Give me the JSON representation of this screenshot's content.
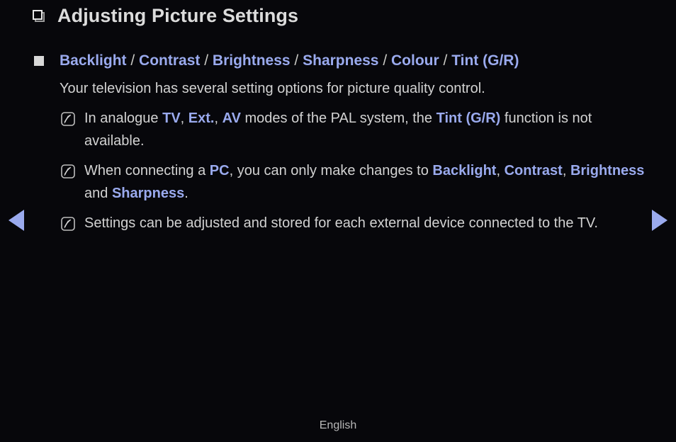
{
  "page": {
    "title": "Adjusting Picture Settings",
    "title_icon": "hollow-square-icon",
    "background_color": "#07070b",
    "accent_color": "#9aaaee",
    "text_color": "#d2d2d2"
  },
  "section": {
    "bullet_icon": "filled-square-bullet",
    "heading_parts": [
      {
        "text": "Backlight",
        "style": "em"
      },
      {
        "text": " / ",
        "style": "sep"
      },
      {
        "text": "Contrast",
        "style": "em"
      },
      {
        "text": " / ",
        "style": "sep"
      },
      {
        "text": "Brightness",
        "style": "em"
      },
      {
        "text": " / ",
        "style": "sep"
      },
      {
        "text": "Sharpness",
        "style": "em"
      },
      {
        "text": " / ",
        "style": "sep"
      },
      {
        "text": "Colour",
        "style": "em"
      },
      {
        "text": " / ",
        "style": "sep"
      },
      {
        "text": "Tint (G/R)",
        "style": "em"
      }
    ],
    "heading_plain": "Backlight / Contrast / Brightness / Sharpness / Colour / Tint (G/R)",
    "description": "Your television has several setting options for picture quality control."
  },
  "notes": [
    {
      "icon": "note-icon",
      "plain": "In analogue TV, Ext., AV modes of the PAL system, the Tint (G/R) function is not available.",
      "parts": [
        {
          "text": "In analogue ",
          "style": "plain"
        },
        {
          "text": "TV",
          "style": "em"
        },
        {
          "text": ", ",
          "style": "plain"
        },
        {
          "text": "Ext.",
          "style": "em"
        },
        {
          "text": ", ",
          "style": "plain"
        },
        {
          "text": "AV",
          "style": "em"
        },
        {
          "text": " modes of the PAL system, the ",
          "style": "plain"
        },
        {
          "text": "Tint (G/R)",
          "style": "em"
        },
        {
          "text": " function is not available.",
          "style": "plain"
        }
      ]
    },
    {
      "icon": "note-icon",
      "plain": "When connecting a PC, you can only make changes to Backlight, Contrast, Brightness and Sharpness.",
      "parts": [
        {
          "text": "When connecting a ",
          "style": "plain"
        },
        {
          "text": "PC",
          "style": "em"
        },
        {
          "text": ", you can only make changes to ",
          "style": "plain"
        },
        {
          "text": "Backlight",
          "style": "em"
        },
        {
          "text": ", ",
          "style": "plain"
        },
        {
          "text": "Contrast",
          "style": "em"
        },
        {
          "text": ", ",
          "style": "plain"
        },
        {
          "text": "Brightness",
          "style": "em"
        },
        {
          "text": " and ",
          "style": "plain"
        },
        {
          "text": "Sharpness",
          "style": "em"
        },
        {
          "text": ".",
          "style": "plain"
        }
      ]
    },
    {
      "icon": "note-icon",
      "plain": "Settings can be adjusted and stored for each external device connected to the TV.",
      "parts": [
        {
          "text": "Settings can be adjusted and stored for each external device connected to the TV.",
          "style": "plain"
        }
      ]
    }
  ],
  "navigation": {
    "prev_label": "◀",
    "prev_name": "previous-page-arrow",
    "next_label": "▶",
    "next_name": "next-page-arrow"
  },
  "footer": {
    "language": "English"
  }
}
